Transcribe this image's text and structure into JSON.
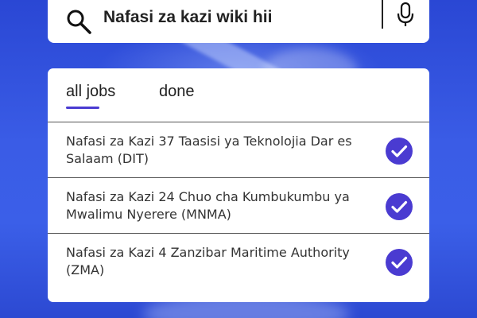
{
  "search": {
    "query": "Nafasi za kazi wiki hii",
    "search_icon": "search-icon",
    "mic_icon": "microphone-icon"
  },
  "tabs": [
    {
      "label": "all jobs",
      "active": true
    },
    {
      "label": "done",
      "active": false
    }
  ],
  "jobs": [
    {
      "title": "Nafasi za Kazi 37 Taasisi ya Teknolojia Dar es Salaam (DIT)",
      "status_icon": "check-circle-icon"
    },
    {
      "title": "Nafasi za Kazi 24 Chuo cha Kumbukumbu ya Mwalimu Nyerere (MNMA)",
      "status_icon": "check-circle-icon"
    },
    {
      "title": "Nafasi za Kazi 4 Zanzibar Maritime Authority (ZMA)",
      "status_icon": "check-circle-icon"
    }
  ],
  "colors": {
    "background": "#2f4fd8",
    "accent": "#4a3bd1",
    "card": "#ffffff"
  }
}
